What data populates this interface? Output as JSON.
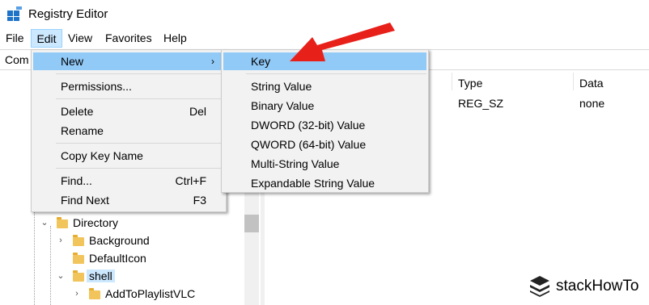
{
  "window": {
    "title": "Registry Editor"
  },
  "menubar": {
    "items": [
      "File",
      "Edit",
      "View",
      "Favorites",
      "Help"
    ],
    "active": "Edit"
  },
  "address": {
    "text": "Com"
  },
  "list": {
    "columns": [
      "Type",
      "Data"
    ],
    "rows": [
      {
        "type": "REG_SZ",
        "data": "none"
      }
    ]
  },
  "tree": {
    "items": [
      {
        "label": "Directory",
        "expanded": true
      },
      {
        "label": "Background",
        "expanded": false
      },
      {
        "label": "DefaultIcon"
      },
      {
        "label": "shell",
        "expanded": true,
        "selected": true
      },
      {
        "label": "AddToPlaylistVLC",
        "expanded": false
      }
    ]
  },
  "edit_menu": {
    "items": [
      {
        "label": "New",
        "has_submenu": true,
        "highlighted": true
      },
      {
        "label": "Permissions..."
      },
      {
        "label": "Delete",
        "shortcut": "Del"
      },
      {
        "label": "Rename"
      },
      {
        "label": "Copy Key Name"
      },
      {
        "label": "Find...",
        "shortcut": "Ctrl+F"
      },
      {
        "label": "Find Next",
        "shortcut": "F3"
      }
    ]
  },
  "new_submenu": {
    "items": [
      {
        "label": "Key",
        "highlighted": true
      },
      {
        "label": "String Value"
      },
      {
        "label": "Binary Value"
      },
      {
        "label": "DWORD (32-bit) Value"
      },
      {
        "label": "QWORD (64-bit) Value"
      },
      {
        "label": "Multi-String Value"
      },
      {
        "label": "Expandable String Value"
      }
    ]
  },
  "watermark": {
    "text": "stackHowTo"
  },
  "colors": {
    "highlight": "#91c9f7",
    "arrow": "#e8201a",
    "selection": "#cce8ff"
  }
}
